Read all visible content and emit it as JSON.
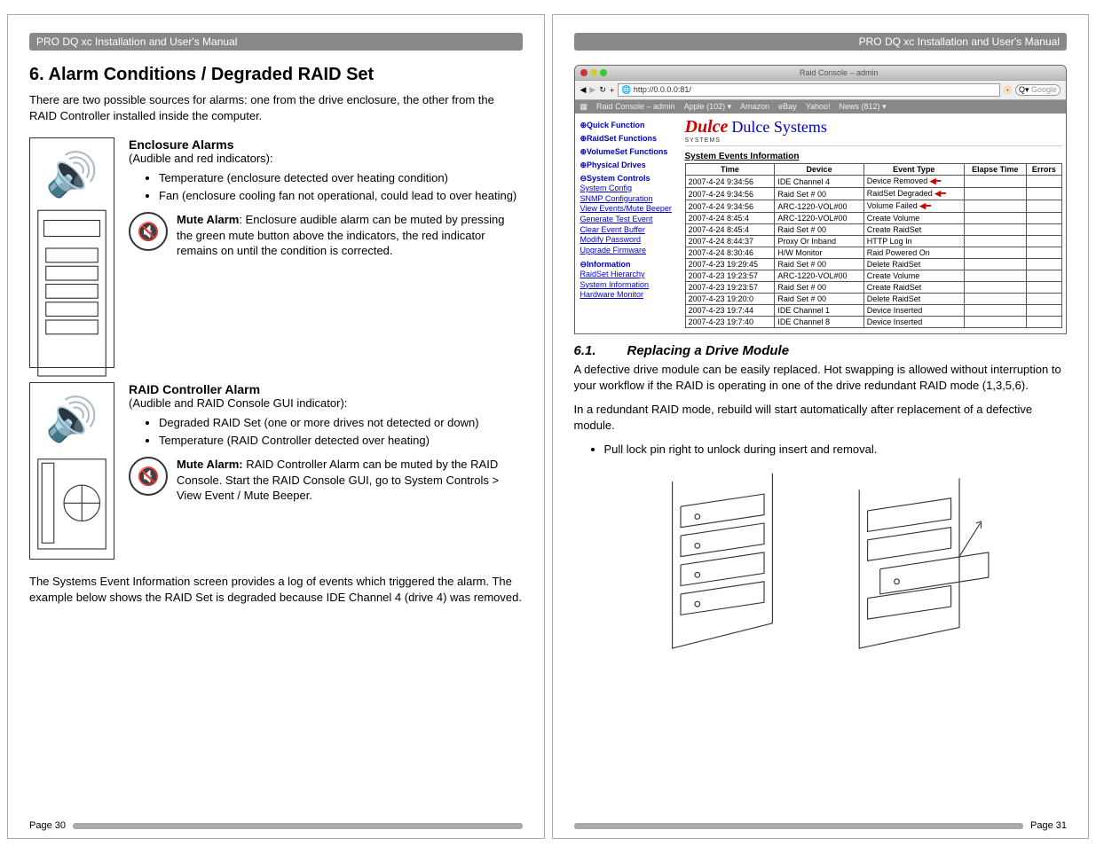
{
  "header": "PRO DQ xc Installation and User's Manual",
  "left": {
    "h1": "6. Alarm Conditions / Degraded RAID Set",
    "intro": "There are two possible sources for alarms: one from the drive enclosure, the other from the RAID Controller installed inside the computer.",
    "enclosure": {
      "title": "Enclosure Alarms",
      "sub": "(Audible and red indicators):",
      "bullets": [
        "Temperature (enclosure detected over heating condition)",
        "Fan (enclosure cooling fan not operational, could lead to over heating)"
      ],
      "mute_label": "Mute Alarm",
      "mute_text": ": Enclosure audible alarm can be muted by pressing the green mute button above the indicators, the red indicator remains on until the condition is corrected."
    },
    "raidctrl": {
      "title": "RAID Controller Alarm",
      "sub": "(Audible and RAID Console GUI indicator):",
      "bullets": [
        "Degraded RAID Set (one or more drives not detected or down)",
        "Temperature (RAID Controller detected over heating)"
      ],
      "mute_label": "Mute Alarm:",
      "mute_text": " RAID Controller Alarm can be muted by the RAID Console.  Start the RAID Console GUI, go to System Controls > View Event / Mute Beeper."
    },
    "outro": "The Systems Event Information screen provides a log of events which triggered the alarm.  The example below shows the RAID Set is degraded because IDE Channel 4 (drive 4) was removed.",
    "pagenum": "Page 30"
  },
  "right": {
    "console": {
      "window_title": "Raid Console – admin",
      "url": "http://0.0.0.0:81/",
      "search_placeholder": "Google",
      "bookmarks": [
        "Raid Console – admin",
        "Apple (102) ▾",
        "Amazon",
        "eBay",
        "Yahoo!",
        "News (812) ▾"
      ],
      "sidebar": [
        {
          "cat": "⊕Quick Function"
        },
        {
          "cat": "⊕RaidSet Functions"
        },
        {
          "cat": "⊕VolumeSet Functions"
        },
        {
          "cat": "⊕Physical Drives"
        },
        {
          "cat": "⊖System Controls"
        },
        {
          "link": "System Config"
        },
        {
          "link": "SNMP Configuration"
        },
        {
          "link": "View Events/Mute Beeper"
        },
        {
          "link": "Generate Test Event"
        },
        {
          "link": "Clear Event Buffer"
        },
        {
          "link": "Modify Password"
        },
        {
          "link": "Upgrade Firmware"
        },
        {
          "cat": "⊖Information"
        },
        {
          "link": "RaidSet Hierarchy"
        },
        {
          "link": "System Information"
        },
        {
          "link": "Hardware Monitor"
        }
      ],
      "brand": "Dulce",
      "brand_sub": "SYSTEMS",
      "brand_tag": "Dulce Systems",
      "table_title": "System Events Information",
      "cols": [
        "Time",
        "Device",
        "Event Type",
        "Elapse Time",
        "Errors"
      ],
      "rows": [
        [
          "2007-4-24 9:34:56",
          "IDE Channel 4",
          "Device Removed",
          "",
          ""
        ],
        [
          "2007-4-24 9:34:56",
          "Raid Set # 00",
          "RaidSet Degraded",
          "",
          ""
        ],
        [
          "2007-4-24 9:34:56",
          "ARC-1220-VOL#00",
          "Volume Failed",
          "",
          ""
        ],
        [
          "2007-4-24 8:45:4",
          "ARC-1220-VOL#00",
          "Create Volume",
          "",
          ""
        ],
        [
          "2007-4-24 8:45:4",
          "Raid Set # 00",
          "Create RaidSet",
          "",
          ""
        ],
        [
          "2007-4-24 8:44:37",
          "Proxy Or Inband",
          "HTTP Log In",
          "",
          ""
        ],
        [
          "2007-4-24 8:30:46",
          "H/W Monitor",
          "Raid Powered On",
          "",
          ""
        ],
        [
          "2007-4-23 19:29:45",
          "Raid Set # 00",
          "Delete RaidSet",
          "",
          ""
        ],
        [
          "2007-4-23 19:23:57",
          "ARC-1220-VOL#00",
          "Create Volume",
          "",
          ""
        ],
        [
          "2007-4-23 19:23:57",
          "Raid Set # 00",
          "Create RaidSet",
          "",
          ""
        ],
        [
          "2007-4-23 19:20:0",
          "Raid Set # 00",
          "Delete RaidSet",
          "",
          ""
        ],
        [
          "2007-4-23 19:7:44",
          "IDE Channel 1",
          "Device Inserted",
          "",
          ""
        ],
        [
          "2007-4-23 19:7:40",
          "IDE Channel 8",
          "Device Inserted",
          "",
          ""
        ]
      ],
      "highlight_rows": [
        0,
        1,
        2
      ]
    },
    "h2_num": "6.1.",
    "h2_title": "Replacing a Drive Module",
    "p1": "A defective drive module can be easily replaced.  Hot swapping is allowed without interruption to your workflow if the RAID is operating in one of the drive redundant RAID mode (1,3,5,6).",
    "p2": "In a redundant RAID mode, rebuild will start automatically after replacement of a defective module.",
    "bullet": "Pull lock pin right to unlock during insert and removal.",
    "pagenum": "Page 31"
  }
}
